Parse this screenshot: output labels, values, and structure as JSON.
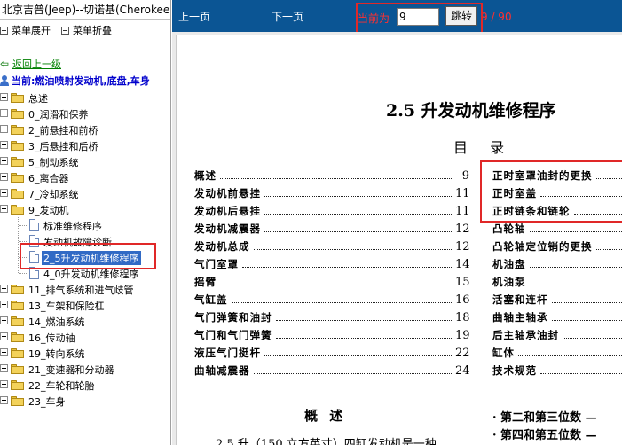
{
  "left": {
    "title": "北京吉普(Jeep)--切诺基(Cherokee)",
    "menu_expand": "菜单展开",
    "menu_collapse": "菜单折叠",
    "back": "返回上一级",
    "current": "当前:燃油喷射发动机,底盘,车身",
    "tree": [
      {
        "label": "总述",
        "expanded": false
      },
      {
        "label": "0_润滑和保养",
        "expanded": false
      },
      {
        "label": "2_前悬挂和前桥",
        "expanded": false
      },
      {
        "label": "3_后悬挂和后桥",
        "expanded": false
      },
      {
        "label": "5_制动系统",
        "expanded": false
      },
      {
        "label": "6_离合器",
        "expanded": false
      },
      {
        "label": "7_冷却系统",
        "expanded": false
      },
      {
        "label": "9_发动机",
        "expanded": true
      }
    ],
    "engine_children": [
      {
        "label": "标准维修程序",
        "selected": false
      },
      {
        "label": "发动机故障诊断",
        "selected": false
      },
      {
        "label": "2_5升发动机维修程序",
        "selected": true
      },
      {
        "label": "4_0升发动机维修程序",
        "selected": false
      }
    ],
    "tree_after": [
      {
        "label": "11_排气系统和进气歧管"
      },
      {
        "label": "13_车架和保险杠"
      },
      {
        "label": "14_燃油系统"
      },
      {
        "label": "16_传动轴"
      },
      {
        "label": "19_转向系统"
      },
      {
        "label": "21_变速器和分动器"
      },
      {
        "label": "22_车轮和轮胎"
      },
      {
        "label": "23_车身"
      }
    ]
  },
  "toolbar": {
    "prev": "上一页",
    "next": "下一页",
    "current_label": "当前为",
    "page_value": "9",
    "jump": "跳转",
    "total": "9 / 90"
  },
  "document": {
    "title": "2.5 升发动机维修程序",
    "toc_heading": "目 录",
    "toc_left": [
      {
        "text": "概述",
        "page": "9"
      },
      {
        "text": "发动机前悬挂",
        "page": "11"
      },
      {
        "text": "发动机后悬挂",
        "page": "11"
      },
      {
        "text": "发动机减震器",
        "page": "12"
      },
      {
        "text": "发动机总成",
        "page": "12"
      },
      {
        "text": "气门室罩",
        "page": "14"
      },
      {
        "text": "摇臂",
        "page": "15"
      },
      {
        "text": "气缸盖",
        "page": "16"
      },
      {
        "text": "气门弹簧和油封",
        "page": "18"
      },
      {
        "text": "气门和气门弹簧",
        "page": "19"
      },
      {
        "text": "液压气门挺杆",
        "page": "22"
      },
      {
        "text": "曲轴减震器",
        "page": "24"
      }
    ],
    "toc_right": [
      {
        "text": "正时室罩油封的更换"
      },
      {
        "text": "正时室盖"
      },
      {
        "text": "正时链条和链轮"
      },
      {
        "text": "凸轮轴"
      },
      {
        "text": "凸轮轴定位销的更换"
      },
      {
        "text": "机油盘"
      },
      {
        "text": "机油泵"
      },
      {
        "text": "活塞和连杆"
      },
      {
        "text": "曲轴主轴承"
      },
      {
        "text": "后主轴承油封"
      },
      {
        "text": "缸体"
      },
      {
        "text": "技术规范"
      }
    ],
    "section_heading": "概 述",
    "body_line": "2.5 升（150 立方英寸）四缸发动机是一种",
    "bullet1": "· 第二和第三位数 — ",
    "bullet2": "· 第四和第五位数 — "
  }
}
